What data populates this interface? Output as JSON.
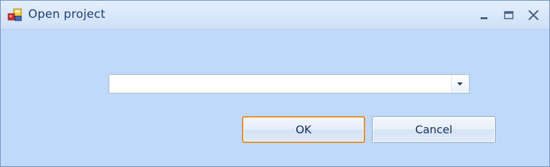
{
  "window": {
    "title": "Open project",
    "app_icon": "project-app-icon",
    "controls": {
      "minimize_icon": "minimize-icon",
      "maximize_icon": "maximize-icon",
      "close_icon": "close-icon"
    }
  },
  "form": {
    "project_select": {
      "value": "",
      "arrow_icon": "chevron-down-icon"
    },
    "ok_label": "OK",
    "cancel_label": "Cancel"
  },
  "colors": {
    "window_background": "#c0d9fb",
    "title_text": "#1e3f73",
    "default_button_border": "#e08e2b"
  }
}
